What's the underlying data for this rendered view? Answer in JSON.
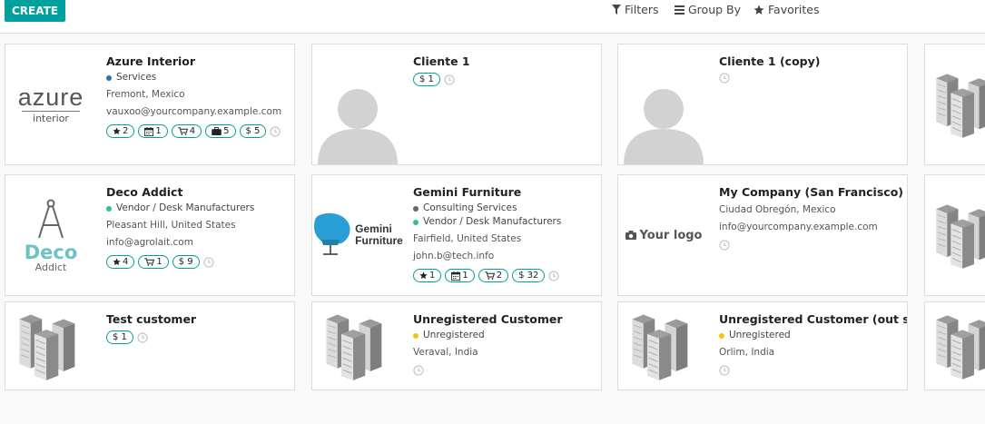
{
  "controlPanel": {
    "create_label": "CREATE",
    "filters_label": "Filters",
    "groupby_label": "Group By",
    "favorites_label": "Favorites"
  },
  "colors": {
    "accent": "#00a09d",
    "blue_tag": "#2f6fb0",
    "green_tag": "#2ebf91",
    "gray_tag": "#666666",
    "yellow_tag": "#f1c40f"
  },
  "cards": [
    {
      "name": "Azure Interior",
      "tags": [
        "Services"
      ],
      "location": "Fremont, Mexico",
      "email": "vauxoo@yourcompany.example.com",
      "badges": {
        "star": "2",
        "calendar": "1",
        "cart": "4",
        "case": "5",
        "dollar": "$ 5"
      },
      "logo_text1": "azure",
      "logo_text2": "interior"
    },
    {
      "name": "Cliente 1",
      "badges": {
        "dollar": "$ 1"
      }
    },
    {
      "name": "Cliente 1 (copy)"
    },
    {
      "name": "Deco Addict",
      "tags": [
        "Vendor / Desk Manufacturers"
      ],
      "location": "Pleasant Hill, United States",
      "email": "info@agrolait.com",
      "badges": {
        "star": "4",
        "cart": "1",
        "dollar": "$ 9"
      },
      "logo_text1": "Deco",
      "logo_text2": "Addict"
    },
    {
      "name": "Gemini Furniture",
      "tags": [
        "Consulting Services",
        "Vendor / Desk Manufacturers"
      ],
      "location": "Fairfield, United States",
      "email": "john.b@tech.info",
      "badges": {
        "star": "1",
        "calendar": "1",
        "cart": "2",
        "dollar": "$ 32"
      },
      "logo_text1": "Gemini",
      "logo_text2": "Furniture"
    },
    {
      "name": "My Company (San Francisco)",
      "location": "Ciudad Obregón, Mexico",
      "email": "info@yourcompany.example.com",
      "logo_text1": "Your logo"
    },
    {
      "name": "Test customer",
      "badges": {
        "dollar": "$ 1"
      }
    },
    {
      "name": "Unregistered Customer",
      "tags": [
        "Unregistered"
      ],
      "location": "Veraval, India"
    },
    {
      "name": "Unregistered Customer (out state)",
      "tags": [
        "Unregistered"
      ],
      "location": "Orlim, India"
    }
  ]
}
